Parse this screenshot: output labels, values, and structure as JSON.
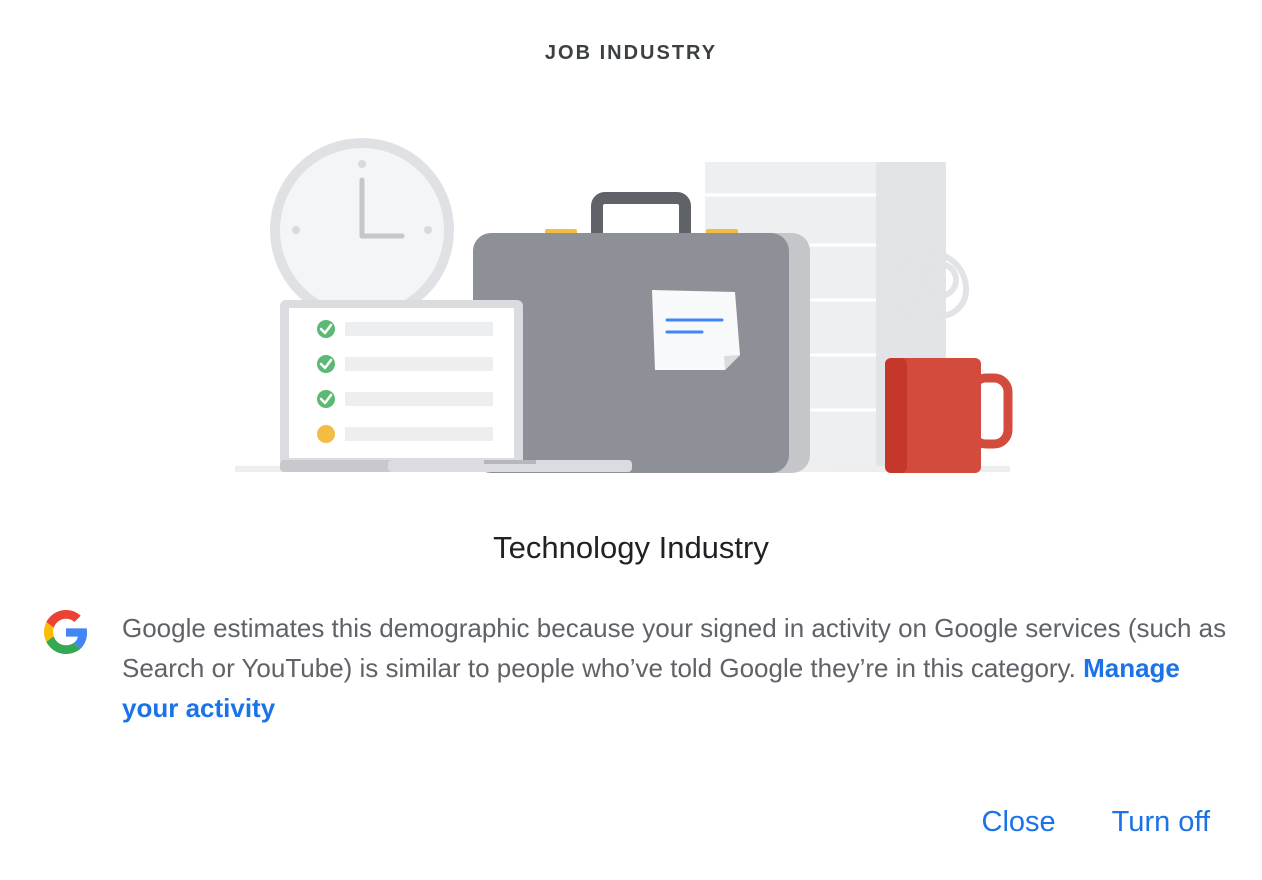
{
  "dialog": {
    "eyebrow": "JOB INDUSTRY",
    "title": "Technology Industry",
    "description": "Google estimates this demographic because your signed in activity on Google services (such as Search or YouTube) is similar to people who’ve told Google they’re in this category.",
    "link_label": "Manage your activity",
    "close_label": "Close",
    "turn_off_label": "Turn off"
  },
  "icons": {
    "brand": "google-g-icon",
    "illustration": "job-industry-illustration"
  },
  "colors": {
    "accent": "#1a73e8",
    "text_primary": "#202124",
    "text_secondary": "#5f6368",
    "mug": "#d34b3d",
    "briefcase": "#8d9096",
    "check": "#5bb974",
    "pending": "#f2bd42"
  }
}
